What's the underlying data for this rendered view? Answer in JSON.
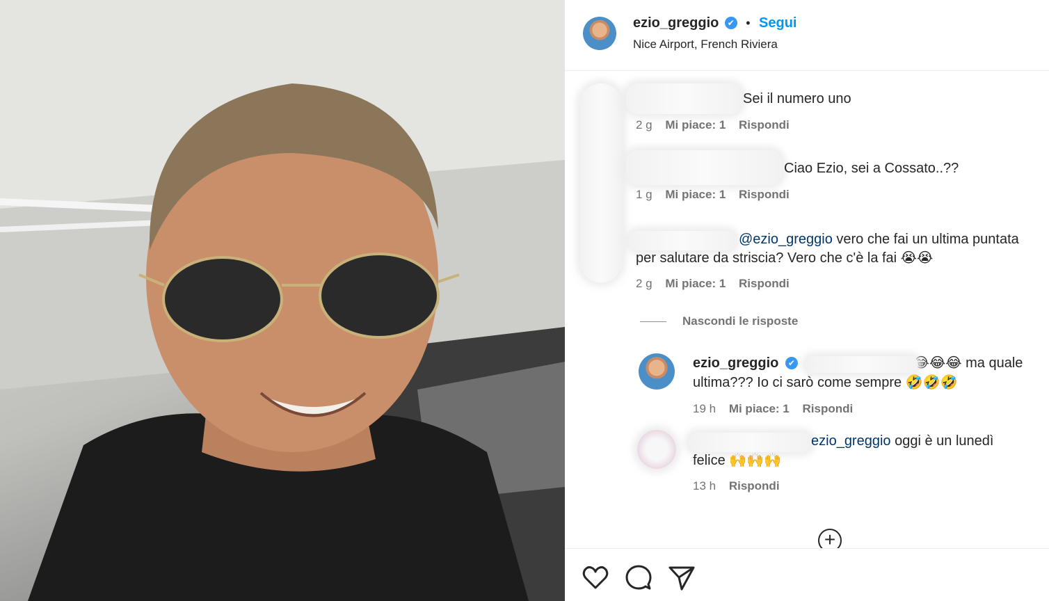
{
  "post": {
    "username": "ezio_greggio",
    "verified_icon": "✔",
    "separator": "•",
    "follow_label": "Segui",
    "location": "Nice Airport, French Riviera"
  },
  "comments": [
    {
      "text": "Sei il numero uno",
      "time": "2 g",
      "likes": "Mi piace: 1",
      "reply": "Rispondi"
    },
    {
      "text": "Ciao Ezio, sei a Cossato..??",
      "time": "1 g",
      "likes": "Mi piace: 1",
      "reply": "Rispondi"
    },
    {
      "mention": "@ezio_greggio",
      "text_line1": " vero che fai un ultima puntata",
      "text_line2": "per salutare da striscia? Vero che c'è la fai 😭😭",
      "time": "2 g",
      "likes": "Mi piace: 1",
      "reply": "Rispondi"
    }
  ],
  "hide_replies": "Nascondi le risposte",
  "replies": [
    {
      "username": "ezio_greggio",
      "line1": "😂😂😂 ma quale",
      "line2": "ultima??? Io ci sarò come sempre 🤣🤣🤣",
      "time": "19 h",
      "likes": "Mi piace: 1",
      "reply": "Rispondi"
    },
    {
      "mention": "ezio_greggio",
      "line1": " oggi è un lunedì",
      "line2": "felice 🙌🙌🙌",
      "time": "13 h",
      "reply": "Rispondi"
    }
  ],
  "icons": {
    "add": "+",
    "like": "heart-icon",
    "comment": "comment-icon",
    "share": "send-icon"
  },
  "colors": {
    "accent": "#0095f6",
    "mention": "#00376b",
    "meta": "#737373"
  }
}
